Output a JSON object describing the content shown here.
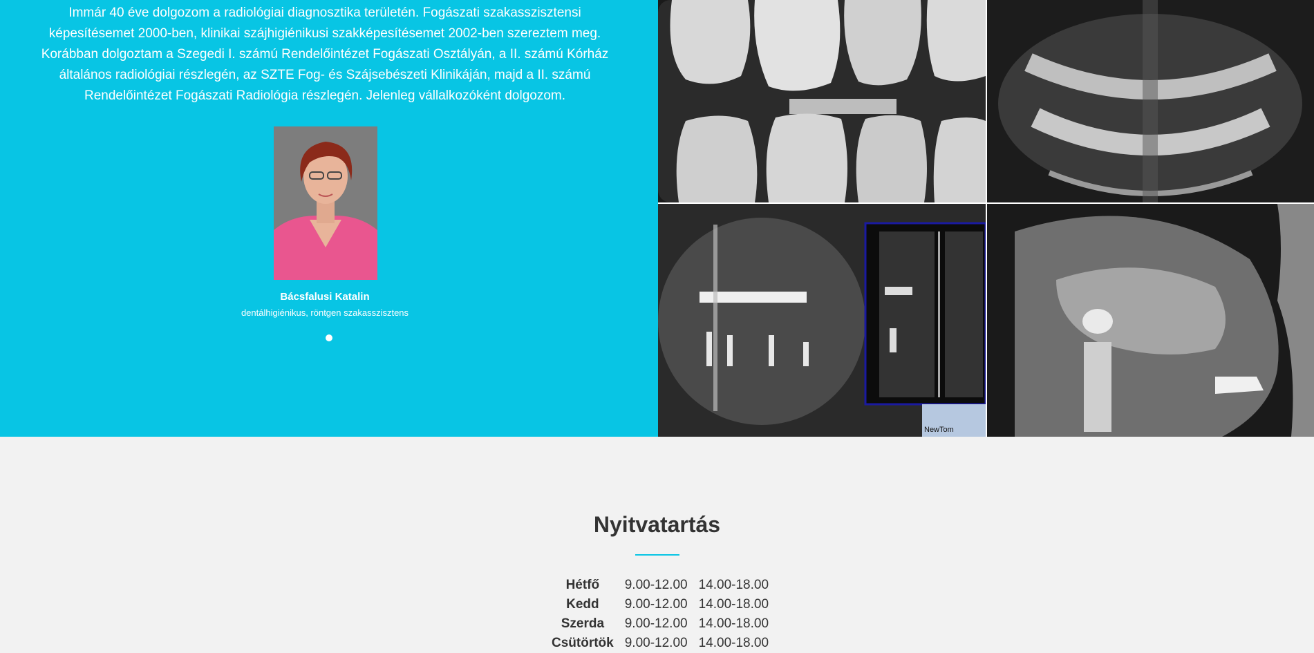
{
  "about": {
    "bio": "Immár 40 éve dolgozom a radiológiai diagnosztika területén. Fogászati szakasszisztensi képesítésemet 2000-ben, klinikai szájhigiénikusi szakképesítésemet 2002-ben szereztem meg. Korábban dolgoztam a Szegedi I. számú Rendelőintézet Fogászati Osztályán, a II. számú Kórház általános radiológiai részlegén, az SZTE Fog- és Szájsebészeti Klinikáján, majd a II. számú Rendelőintézet Fogászati Radiológia részlegén. Jelenleg vállalkozóként dolgozom.",
    "name": "Bácsfalusi Katalin",
    "role": "dentálhigiénikus, röntgen szakasszisztens",
    "accent": "#08c5e4"
  },
  "xray_labels": {
    "ct_brand": "NewTom"
  },
  "hours": {
    "title": "Nyitvatartás",
    "rows": [
      {
        "day": "Hétfő",
        "morning": "9.00-12.00",
        "afternoon": "14.00-18.00"
      },
      {
        "day": "Kedd",
        "morning": "9.00-12.00",
        "afternoon": "14.00-18.00"
      },
      {
        "day": "Szerda",
        "morning": "9.00-12.00",
        "afternoon": "14.00-18.00"
      },
      {
        "day": "Csütörtök",
        "morning": "9.00-12.00",
        "afternoon": "14.00-18.00"
      }
    ]
  }
}
